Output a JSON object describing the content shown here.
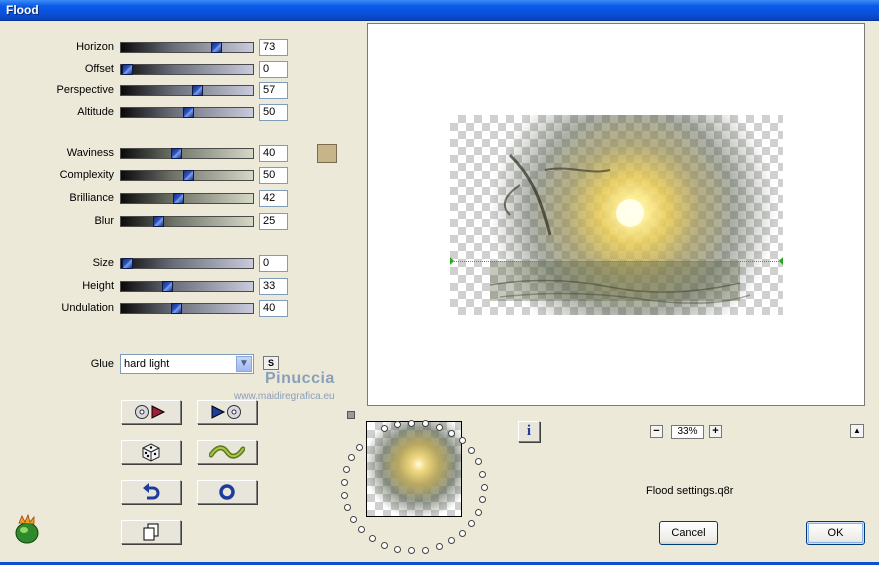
{
  "window": {
    "title": "Flood"
  },
  "sliders": [
    {
      "id": "horizon",
      "label": "Horizon",
      "value": "73",
      "fraction": 0.73,
      "track": "cool"
    },
    {
      "id": "offset",
      "label": "Offset",
      "value": "0",
      "fraction": 0.0,
      "track": "cool"
    },
    {
      "id": "perspective",
      "label": "Perspective",
      "value": "57",
      "fraction": 0.57,
      "track": "cool"
    },
    {
      "id": "altitude",
      "label": "Altitude",
      "value": "50",
      "fraction": 0.5,
      "track": "cool"
    },
    {
      "id": "waviness",
      "label": "Waviness",
      "value": "40",
      "fraction": 0.4,
      "track": "warm"
    },
    {
      "id": "complexity",
      "label": "Complexity",
      "value": "50",
      "fraction": 0.5,
      "track": "warm"
    },
    {
      "id": "brilliance",
      "label": "Brilliance",
      "value": "42",
      "fraction": 0.42,
      "track": "warm"
    },
    {
      "id": "blur",
      "label": "Blur",
      "value": "25",
      "fraction": 0.25,
      "track": "warm"
    },
    {
      "id": "size",
      "label": "Size",
      "value": "0",
      "fraction": 0.0,
      "track": "cool"
    },
    {
      "id": "height",
      "label": "Height",
      "value": "33",
      "fraction": 0.33,
      "track": "cool"
    },
    {
      "id": "undulation",
      "label": "Undulation",
      "value": "40",
      "fraction": 0.4,
      "track": "cool"
    }
  ],
  "color_swatch": {
    "color": "#c7b488"
  },
  "glue": {
    "label": "Glue",
    "value": "hard light",
    "s_button": "S"
  },
  "watermark": {
    "line1": "Pinuccia",
    "line2": "www.maidiregrafica.eu"
  },
  "tool_buttons": [
    {
      "name": "open-preset-button",
      "icon": "disc-with-arrow-icon"
    },
    {
      "name": "save-preset-button",
      "icon": "arrow-to-disc-icon"
    },
    {
      "name": "randomize-button",
      "icon": "dice-icon"
    },
    {
      "name": "wave-button",
      "icon": "wave-icon"
    },
    {
      "name": "undo-button",
      "icon": "undo-arrow-icon"
    },
    {
      "name": "reset-button",
      "icon": "ring-icon"
    },
    {
      "name": "copy-button",
      "icon": "pages-icon"
    }
  ],
  "preview": {
    "zoom": "33%",
    "zoom_minus": "−",
    "zoom_plus": "+",
    "collapse": "▲"
  },
  "info_button": "i",
  "preset_file": "Flood settings.q8r",
  "buttons": {
    "cancel": "Cancel",
    "ok": "OK"
  },
  "colors": {
    "titlebar": "#0a50d8",
    "dialog_bg": "#ece9d8",
    "slider_thumb": "#2f57c8"
  }
}
